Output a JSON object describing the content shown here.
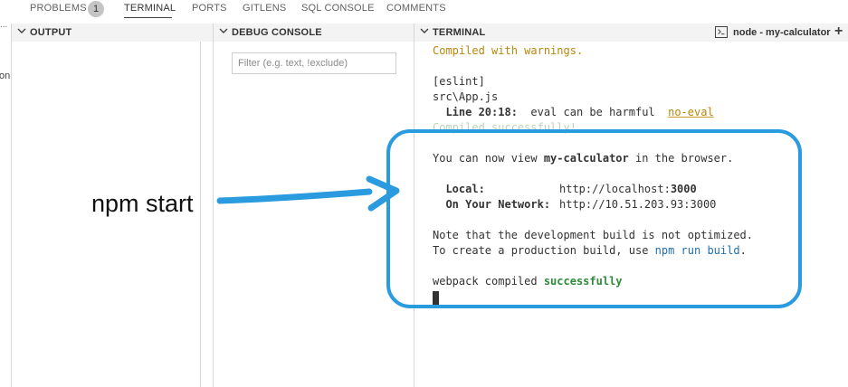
{
  "tabs": [
    {
      "label": "PROBLEMS"
    },
    {
      "label": "TERMINAL"
    },
    {
      "label": "PORTS"
    },
    {
      "label": "GITLENS"
    },
    {
      "label": "SQL CONSOLE"
    },
    {
      "label": "COMMENTS"
    }
  ],
  "problems_count": "1",
  "left_stub": {
    "ellipsis": "...",
    "text": "on"
  },
  "panels": {
    "output": {
      "title": "OUTPUT"
    },
    "debug": {
      "title": "DEBUG CONSOLE",
      "filter_placeholder": "Filter (e.g. text, !exclude)"
    },
    "terminal": {
      "title": "TERMINAL",
      "task_label": "node - my-calculator",
      "add_icon": "+"
    }
  },
  "terminal": {
    "compiled_warnings": "Compiled with warnings.",
    "eslint": "[eslint]",
    "file": "src\\App.js",
    "line_loc": "  Line 20:18:",
    "line_msg": "  eval can be harmful  ",
    "rule": "no-eval",
    "compiled_success": "Compiled successfully!",
    "view_prefix": "You can now view ",
    "app_name": "my-calculator",
    "view_suffix": " in the browser.",
    "local_label": "  Local:",
    "local_url_prefix": "http://localhost:",
    "local_port": "3000",
    "network_label": "  On Your Network:",
    "network_url": "http://10.51.203.93:3000",
    "note_line": "Note that the development build is not optimized.",
    "prod_prefix": "To create a production build, use ",
    "prod_cmd": "npm run build",
    "prod_suffix": ".",
    "webpack_prefix": "webpack compiled ",
    "webpack_status": "successfully"
  },
  "annotation": {
    "label": "npm start",
    "color": "#2b9be0"
  },
  "colors": {
    "warning": "#b8860b",
    "success": "#2e8b3a",
    "link": "#1e6fb3"
  }
}
